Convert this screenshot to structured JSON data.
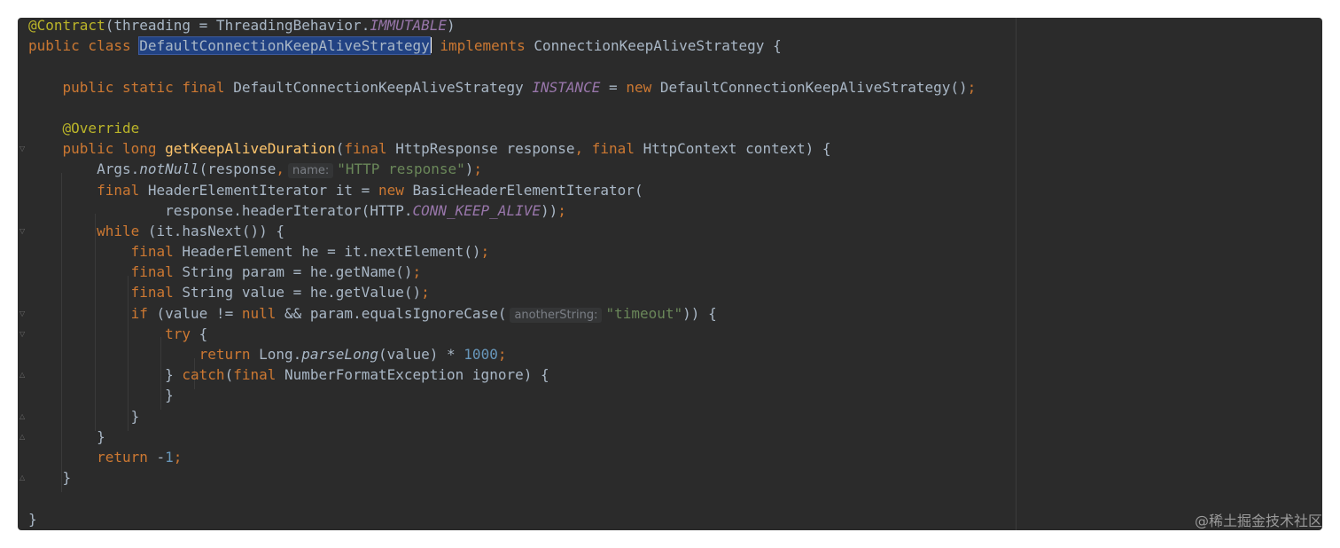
{
  "editor": {
    "lines": [
      [
        [
          "ann",
          "@Contract"
        ],
        [
          "",
          "(threading = ThreadingBehavior."
        ],
        [
          "cst",
          "IMMUTABLE"
        ],
        [
          "",
          ")"
        ]
      ],
      [
        [
          "kw",
          "public class "
        ],
        [
          "sel",
          "DefaultConnectionKeepAliveStrategy"
        ],
        [
          "caret",
          ""
        ],
        [
          "kw",
          " implements "
        ],
        [
          "",
          "ConnectionKeepAliveStrategy {"
        ]
      ],
      [],
      [
        [
          "",
          "    "
        ],
        [
          "kw",
          "public static final "
        ],
        [
          "",
          "DefaultConnectionKeepAliveStrategy "
        ],
        [
          "cst",
          "INSTANCE"
        ],
        [
          "",
          " = "
        ],
        [
          "kw",
          "new "
        ],
        [
          "",
          "DefaultConnectionKeepAliveStrategy()"
        ],
        [
          "kw",
          ";"
        ]
      ],
      [],
      [
        [
          "",
          "    "
        ],
        [
          "ann",
          "@Override"
        ]
      ],
      [
        [
          "",
          "    "
        ],
        [
          "kw",
          "public long "
        ],
        [
          "fn",
          "getKeepAliveDuration"
        ],
        [
          "",
          "("
        ],
        [
          "kw",
          "final "
        ],
        [
          "",
          "HttpResponse response"
        ],
        [
          "kw",
          ", final "
        ],
        [
          "",
          "HttpContext context) {"
        ]
      ],
      [
        [
          "",
          "        Args."
        ],
        [
          "stat",
          "notNull"
        ],
        [
          "",
          "(response"
        ],
        [
          "kw",
          ","
        ],
        [
          "hint",
          "name:"
        ],
        [
          "str",
          "\"HTTP response\""
        ],
        [
          "",
          ")"
        ],
        [
          "kw",
          ";"
        ]
      ],
      [
        [
          "",
          "        "
        ],
        [
          "kw",
          "final "
        ],
        [
          "",
          "HeaderElementIterator it = "
        ],
        [
          "kw",
          "new "
        ],
        [
          "",
          "BasicHeaderElementIterator("
        ]
      ],
      [
        [
          "",
          "                response.headerIterator(HTTP."
        ],
        [
          "cst",
          "CONN_KEEP_ALIVE"
        ],
        [
          "",
          "))"
        ],
        [
          "kw",
          ";"
        ]
      ],
      [
        [
          "",
          "        "
        ],
        [
          "kw",
          "while "
        ],
        [
          "",
          "(it.hasNext()) {"
        ]
      ],
      [
        [
          "",
          "            "
        ],
        [
          "kw",
          "final "
        ],
        [
          "",
          "HeaderElement he = it.nextElement()"
        ],
        [
          "kw",
          ";"
        ]
      ],
      [
        [
          "",
          "            "
        ],
        [
          "kw",
          "final "
        ],
        [
          "",
          "String param = he.getName()"
        ],
        [
          "kw",
          ";"
        ]
      ],
      [
        [
          "",
          "            "
        ],
        [
          "kw",
          "final "
        ],
        [
          "",
          "String value = he.getValue()"
        ],
        [
          "kw",
          ";"
        ]
      ],
      [
        [
          "",
          "            "
        ],
        [
          "kw",
          "if "
        ],
        [
          "",
          "(value != "
        ],
        [
          "kw",
          "null "
        ],
        [
          "",
          "&& param.equalsIgnoreCase("
        ],
        [
          "hint",
          "anotherString:"
        ],
        [
          "str",
          "\"timeout\""
        ],
        [
          "",
          ")) {"
        ]
      ],
      [
        [
          "",
          "                "
        ],
        [
          "kw",
          "try "
        ],
        [
          "",
          "{"
        ]
      ],
      [
        [
          "",
          "                    "
        ],
        [
          "kw",
          "return "
        ],
        [
          "",
          "Long."
        ],
        [
          "stat",
          "parseLong"
        ],
        [
          "",
          "(value) * "
        ],
        [
          "num",
          "1000"
        ],
        [
          "kw",
          ";"
        ]
      ],
      [
        [
          "",
          "                } "
        ],
        [
          "kw",
          "catch"
        ],
        [
          "",
          "("
        ],
        [
          "kw",
          "final "
        ],
        [
          "",
          "NumberFormatException ignore) {"
        ]
      ],
      [
        [
          "",
          "                }"
        ]
      ],
      [
        [
          "",
          "            }"
        ]
      ],
      [
        [
          "",
          "        }"
        ]
      ],
      [
        [
          "",
          "        "
        ],
        [
          "kw",
          "return "
        ],
        [
          "",
          "-"
        ],
        [
          "num",
          "1"
        ],
        [
          "kw",
          ";"
        ]
      ],
      [
        [
          "",
          "    }"
        ]
      ],
      [],
      [
        [
          "",
          "}"
        ]
      ]
    ]
  },
  "watermark": "@稀土掘金技术社区"
}
